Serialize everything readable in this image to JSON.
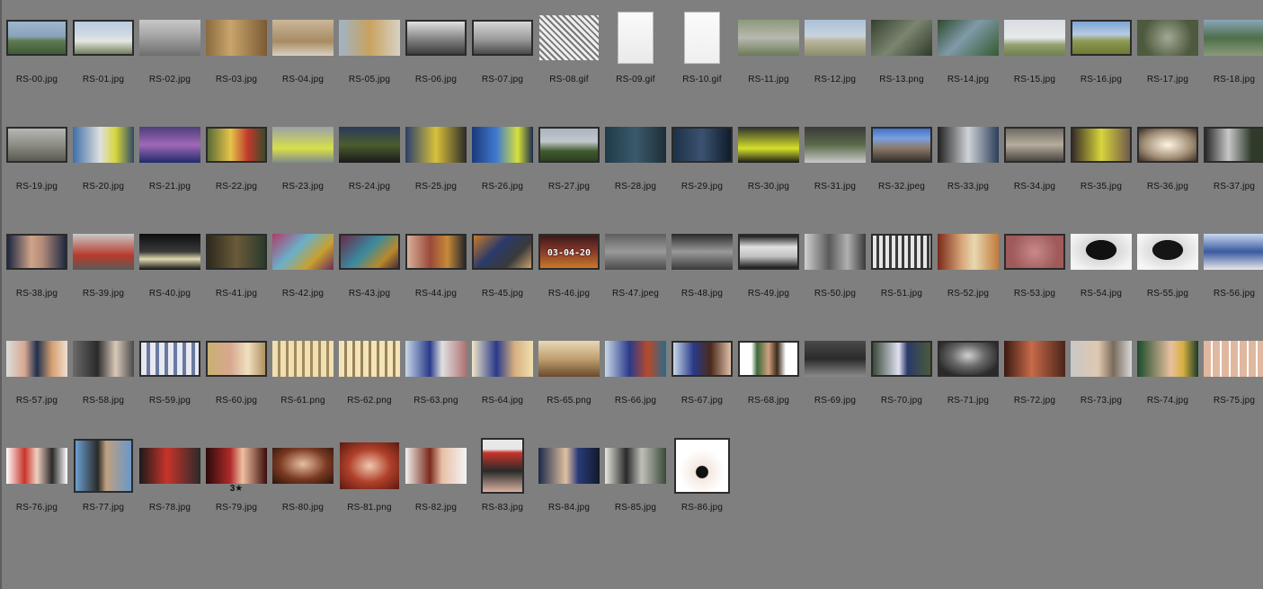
{
  "colors": {
    "background": "#7f7f7f",
    "label_text": "#111111",
    "thumb_border": "#2b2b2b"
  },
  "items": [
    {
      "name": "RS-00.jpg",
      "bg": "linear-gradient(#9fb7cf 0%,#8aa3ba 45%,#5f7a52 60%,#3e5a36 100%)",
      "border": true
    },
    {
      "name": "RS-01.jpg",
      "bg": "linear-gradient(#b9cde0 0%,#cfd9e2 40%,#e6e6e2 60%,#6e7f5c 100%)",
      "border": true
    },
    {
      "name": "RS-02.jpg",
      "bg": "linear-gradient(#c8c8c8 0%,#a9a9a9 40%,#6e6e6e 100%)",
      "border": false
    },
    {
      "name": "RS-03.jpg",
      "bg": "linear-gradient(90deg,#8a6a3e,#c9a56c 40%,#7b5a34)",
      "border": false
    },
    {
      "name": "RS-04.jpg",
      "bg": "linear-gradient(#cbb79a,#a88b63 60%,#d9d0c0)",
      "border": false
    },
    {
      "name": "RS-05.jpg",
      "bg": "linear-gradient(90deg,#9fb4c8,#c8a25f 50%,#d8d2c4)",
      "border": false
    },
    {
      "name": "RS-06.jpg",
      "bg": "linear-gradient(#e1e1e1,#8a8a8a 50%,#3d3d3d)",
      "border": true
    },
    {
      "name": "RS-07.jpg",
      "bg": "linear-gradient(#d7d7d7,#9a9a9a 55%,#4a4a4a)",
      "border": true
    },
    {
      "name": "RS-08.gif",
      "bg": "repeating-linear-gradient(45deg,#eee 0 3px,#777 3px 5px)",
      "border": false,
      "w": 66,
      "h": 50
    },
    {
      "name": "RS-09.gif",
      "bg": "linear-gradient(#fafafa,#eaeaea)",
      "border": false,
      "doc": true,
      "w": 40,
      "h": 58
    },
    {
      "name": "RS-10.gif",
      "bg": "linear-gradient(#fbfbfb,#efefef)",
      "border": false,
      "doc": true,
      "w": 40,
      "h": 58
    },
    {
      "name": "RS-11.jpg",
      "bg": "linear-gradient(#8c9a7a,#b8b8b0 50%,#6a7a58)",
      "border": false
    },
    {
      "name": "RS-12.jpg",
      "bg": "linear-gradient(#aac0d6 0%,#c8d4de 45%,#b9b39a 60%,#8a8f6a 100%)",
      "border": false
    },
    {
      "name": "RS-13.png",
      "bg": "linear-gradient(135deg,#34402e,#7b8570 50%,#2e3a2a)",
      "border": false
    },
    {
      "name": "RS-14.jpg",
      "bg": "linear-gradient(135deg,#2f4a2c,#7f9aa8 45%,#355b30)",
      "border": false
    },
    {
      "name": "RS-15.jpg",
      "bg": "linear-gradient(#d8dde2 0%,#e7e9ea 50%,#93a070 70%,#6f7f4f 100%)",
      "border": false
    },
    {
      "name": "RS-16.jpg",
      "bg": "linear-gradient(#7ea6d6 0%,#b9cbe0 40%,#8f9a52 60%,#6b7a34 100%)",
      "border": true
    },
    {
      "name": "RS-17.jpg",
      "bg": "radial-gradient(circle at 50% 50%,#a1a895,#4d5a3d 70%)",
      "border": false
    },
    {
      "name": "RS-18.jpg",
      "bg": "linear-gradient(#8aa6b8,#4e6f4a 50%,#8a9a7a)",
      "border": false
    },
    {
      "name": "RS-19.jpg",
      "bg": "linear-gradient(#b7b7b3 0%,#8d8d86 50%,#5a5a52 100%)",
      "border": true
    },
    {
      "name": "RS-20.jpg",
      "bg": "linear-gradient(90deg,#3d6ea8,#e0e0e0 45%,#d6d63a 70%,#2f4a6a)",
      "border": false
    },
    {
      "name": "RS-21.jpg",
      "bg": "linear-gradient(#4d3f7a,#a068b8 50%,#1f2b6a)",
      "border": false
    },
    {
      "name": "RS-22.jpg",
      "bg": "linear-gradient(90deg,#5a6a38,#e6c44a 40%,#c0392b 70%,#3b4a2a)",
      "border": true
    },
    {
      "name": "RS-23.jpg",
      "bg": "linear-gradient(#9aa2a8,#d8e04a 60%,#808a8a)",
      "border": false
    },
    {
      "name": "RS-24.jpg",
      "bg": "linear-gradient(#2a3a5a,#4b5c2d 50%,#1a1a1a)",
      "border": false
    },
    {
      "name": "RS-25.jpg",
      "bg": "linear-gradient(90deg,#2c3f6b,#d8c13a 50%,#2a2a2a)",
      "border": false
    },
    {
      "name": "RS-26.jpg",
      "bg": "linear-gradient(90deg,#1a3a7a,#3f7ad0 40%,#d7e03a 75%,#1b2b4a)",
      "border": false
    },
    {
      "name": "RS-27.jpg",
      "bg": "linear-gradient(#a9b4bf 0%,#c2c8cc 40%,#3f5a2f 70%,#2d3f24 100%)",
      "border": true
    },
    {
      "name": "RS-28.jpg",
      "bg": "linear-gradient(90deg,#1f3b4a,#3a5a6a 50%,#1e2e38)",
      "border": false
    },
    {
      "name": "RS-29.jpg",
      "bg": "linear-gradient(90deg,#1d3148,#3b5270 50%,#0f1c2b)",
      "border": true
    },
    {
      "name": "RS-30.jpg",
      "bg": "linear-gradient(#2b2f2f,#d6e02a 60%,#1b1b1b)",
      "border": false
    },
    {
      "name": "RS-31.jpg",
      "bg": "linear-gradient(#3a3a3a,#5b6a4a 50%,#c9c9c9)",
      "border": false
    },
    {
      "name": "RS-32.jpeg",
      "bg": "linear-gradient(#3f72c9 0%,#7aa0de 30%,#8a7a6a 60%,#3a342e 100%)",
      "border": true
    },
    {
      "name": "RS-33.jpg",
      "bg": "linear-gradient(90deg,#202020,#cfd3d6 50%,#2c3e5a)",
      "border": false
    },
    {
      "name": "RS-34.jpg",
      "bg": "linear-gradient(#6f6a62,#b5ad9e 50%,#4a4540)",
      "border": true
    },
    {
      "name": "RS-35.jpg",
      "bg": "linear-gradient(90deg,#3a2e28,#d8d53c 50%,#6f5a4a)",
      "border": true
    },
    {
      "name": "RS-36.jpg",
      "bg": "radial-gradient(ellipse at 50% 50%,#fff4e4,#a08c74 60%,#3a2e24)",
      "border": true
    },
    {
      "name": "RS-37.jpg",
      "bg": "linear-gradient(90deg,#2a2a2a,#c8c8c8 40%,#2f3a2a 80%)",
      "border": true
    },
    {
      "name": "RS-38.jpg",
      "bg": "linear-gradient(90deg,#1f2a44,#d0a38a 40%,#b28a78 60%,#1f2a44)",
      "border": true
    },
    {
      "name": "RS-39.jpg",
      "bg": "linear-gradient(#c9c9c9,#b83a2a 60%,#5a5a5a)",
      "border": false
    },
    {
      "name": "RS-40.jpg",
      "bg": "linear-gradient(#0e0e0e,#3a3a3a 50%,#e0d8b0 70%,#111)",
      "border": false
    },
    {
      "name": "RS-41.jpg",
      "bg": "linear-gradient(90deg,#2e2a1e,#6a5a3a 50%,#2a3a2a)",
      "border": true
    },
    {
      "name": "RS-42.jpg",
      "bg": "linear-gradient(135deg,#b13a6a,#6ab0c9 40%,#c8a030 70%,#6a2a5a)",
      "border": false
    },
    {
      "name": "RS-43.jpg",
      "bg": "linear-gradient(135deg,#6a2a4a,#3a8aa0 45%,#b9892a 75%,#4a2a3a)",
      "border": true
    },
    {
      "name": "RS-44.jpg",
      "bg": "linear-gradient(90deg,#d8b09a,#9a4a3a 40%,#c78a3a 70%,#2a2a2a)",
      "border": true
    },
    {
      "name": "RS-45.jpg",
      "bg": "linear-gradient(135deg,#c87a2a,#2a3a6a 40%,#3a3a3a 70%,#c8a06a)",
      "border": true
    },
    {
      "name": "RS-46.jpg",
      "bg": "linear-gradient(#3a1a1a,#8a3a2a 50%,#c8782a)",
      "border": true,
      "overlay": "03-04-20"
    },
    {
      "name": "RS-47.jpeg",
      "bg": "linear-gradient(#5f5f5f,#9a9a9a 50%,#4a4a4a)",
      "border": false
    },
    {
      "name": "RS-48.jpg",
      "bg": "linear-gradient(#2a2a2a,#9a9a9a 50%,#3a3a3a)",
      "border": false
    },
    {
      "name": "RS-49.jpg",
      "bg": "linear-gradient(#1a1a1a,#e0e0e0 35%,#c0c0c0 65%,#1a1a1a)",
      "border": true
    },
    {
      "name": "RS-50.jpg",
      "bg": "linear-gradient(90deg,#d0d0d0,#5a5a5a 40%,#b0b0b0 70%,#3a3a3a)",
      "border": false
    },
    {
      "name": "RS-51.jpg",
      "bg": "repeating-linear-gradient(90deg,#e6e6e6 0 4px,#3a3a3a 4px 7px)",
      "border": true
    },
    {
      "name": "RS-52.jpg",
      "bg": "linear-gradient(90deg,#7a2a1a,#d8a87a 40%,#e8d8b0 60%,#c07a3a)",
      "border": false
    },
    {
      "name": "RS-53.jpg",
      "bg": "radial-gradient(circle,#c88a8a,#a05a5a 70%)",
      "border": true
    },
    {
      "name": "RS-54.jpg",
      "bg": "radial-gradient(ellipse at 50% 45%,#111 35%,#d8d8d8 36%,#f4f4f4 80%)",
      "border": false
    },
    {
      "name": "RS-55.jpg",
      "bg": "radial-gradient(ellipse at 50% 45%,#151515 35%,#dcdcdc 36%,#f6f6f6 80%)",
      "border": false
    },
    {
      "name": "RS-56.jpg",
      "bg": "linear-gradient(#c8d8f0,#3a5aa0 50%,#e8e8e8)",
      "border": false
    },
    {
      "name": "RS-57.jpg",
      "bg": "linear-gradient(90deg,#dcdcdc,#d8a890 30%,#203050 50%,#d6a070 75%,#f0e0d0)",
      "border": false
    },
    {
      "name": "RS-58.jpg",
      "bg": "linear-gradient(90deg,#6a6a6a,#2a2a2a 40%,#d8c8b8 70%,#4a4a4a)",
      "border": false
    },
    {
      "name": "RS-59.jpg",
      "bg": "repeating-linear-gradient(90deg,#e8e8f0 0 6px,#6a7aa0 6px 10px)",
      "border": true
    },
    {
      "name": "RS-60.jpg",
      "bg": "linear-gradient(90deg,#c8b070,#d8a890 40%,#f0e0c0 70%,#b09060)",
      "border": true
    },
    {
      "name": "RS-61.png",
      "bg": "repeating-linear-gradient(90deg,#f0e0b0 0 6px,#a08860 6px 9px)",
      "border": false
    },
    {
      "name": "RS-62.png",
      "bg": "repeating-linear-gradient(90deg,#f2e4b8 0 6px,#9a8058 6px 9px)",
      "border": false
    },
    {
      "name": "RS-63.png",
      "bg": "linear-gradient(90deg,#c8d8e8,#2a3a8a 40%,#e0e0e0 60%,#b07070)",
      "border": false
    },
    {
      "name": "RS-64.jpg",
      "bg": "linear-gradient(90deg,#f0e6c8,#2a3a8a 40%,#d8b080 70%,#f0e0b0)",
      "border": false
    },
    {
      "name": "RS-65.png",
      "bg": "linear-gradient(#e8d8b8 0%,#c0a070 50%,#6a4a2a 100%)",
      "border": false
    },
    {
      "name": "RS-66.jpg",
      "bg": "linear-gradient(90deg,#c8d8e8,#2a3a8a 40%,#b84a2a 70%,#2a6a8a)",
      "border": false
    },
    {
      "name": "RS-67.jpg",
      "bg": "linear-gradient(90deg,#c8d8e8,#2a3a8a 35%,#4a2a1a 65%,#e0c0a8)",
      "border": true
    },
    {
      "name": "RS-68.jpg",
      "bg": "linear-gradient(90deg,#ffffff 0 20%,#3a6a3a 30%,#d0a080 50%,#3a2a1a 65%,#ffffff 80%)",
      "border": true
    },
    {
      "name": "RS-69.jpg",
      "bg": "linear-gradient(#4a4a4a,#2a2a2a 50%,#8a8a8a)",
      "border": false
    },
    {
      "name": "RS-70.jpg",
      "bg": "linear-gradient(90deg,#3a4a3a,#e0e0f0 45%,#2a3a6a 60%,#4a5a3a)",
      "border": true
    },
    {
      "name": "RS-71.jpg",
      "bg": "radial-gradient(ellipse at 50% 40%,#d0d0d0,#6a6a6a 40%,#2a2a2a 80%)",
      "border": true
    },
    {
      "name": "RS-72.jpg",
      "bg": "linear-gradient(90deg,#3a1a12,#c86a4a 45%,#4a2418)",
      "border": false
    },
    {
      "name": "RS-73.jpg",
      "bg": "linear-gradient(90deg,#c8c8c8,#e0c8b0 45%,#7a6a5a 70%,#d8d8d8)",
      "border": false
    },
    {
      "name": "RS-74.jpg",
      "bg": "linear-gradient(90deg,#1a4a2a,#e8c0a0 55%,#d8b040 75%,#1a3a2a)",
      "border": false
    },
    {
      "name": "RS-75.jpg",
      "bg": "repeating-linear-gradient(90deg,#e0b8a0 0 8px,#ffffff 8px 10px)",
      "border": false
    },
    {
      "name": "RS-76.jpg",
      "bg": "linear-gradient(90deg,#ffffff,#c8342a 30%,#f0d0c0 50%,#2a2a2a 75%,#ffffff)",
      "border": false
    },
    {
      "name": "RS-77.jpg",
      "bg": "linear-gradient(90deg,#6aa0d0,#2a2a2a 40%,#c0a080 55%,#6a98c8)",
      "border": true,
      "w": 66,
      "h": 60
    },
    {
      "name": "RS-78.jpg",
      "bg": "linear-gradient(90deg,#1a1a1a,#c8342a 45%,#2a2a2a)",
      "border": false
    },
    {
      "name": "RS-79.jpg",
      "bg": "linear-gradient(90deg,#2a0a0a,#b02a2a 40%,#f0c0a0 60%,#3a0a0a)",
      "border": false,
      "rating": "3★"
    },
    {
      "name": "RS-80.jpg",
      "bg": "radial-gradient(ellipse at 50% 45%,#e8c0a0,#7a3a22 55%,#2a120a)",
      "border": false
    },
    {
      "name": "RS-81.png",
      "bg": "radial-gradient(ellipse at 50% 50%,#f0c8b0,#b0402a 50%,#5a1a10)",
      "border": false,
      "w": 66,
      "h": 52
    },
    {
      "name": "RS-82.jpg",
      "bg": "linear-gradient(90deg,#f2f2f2,#7a2a1a 40%,#e8c0a8 60%,#f4f4f4)",
      "border": false
    },
    {
      "name": "RS-83.jpg",
      "bg": "linear-gradient(#e8e8e8 0 18%,#c8342a 25%,#2a2a2a 60%,#d8b0a0)",
      "border": true,
      "w": 48,
      "h": 62
    },
    {
      "name": "RS-84.jpg",
      "bg": "linear-gradient(90deg,#1a2a4a,#e0c0a0 45%,#2a3a7a 65%,#101a2a)",
      "border": false
    },
    {
      "name": "RS-85.jpg",
      "bg": "linear-gradient(90deg,#e8e8e0,#2a2a2a 35%,#c0c0b8 60%,#3a4a3a)",
      "border": false
    },
    {
      "name": "RS-86.jpg",
      "bg": "radial-gradient(circle at 50% 62%,#111 14%,#f4e8e0 16%,#ffffff 55%)",
      "border": true,
      "w": 62,
      "h": 62
    }
  ]
}
